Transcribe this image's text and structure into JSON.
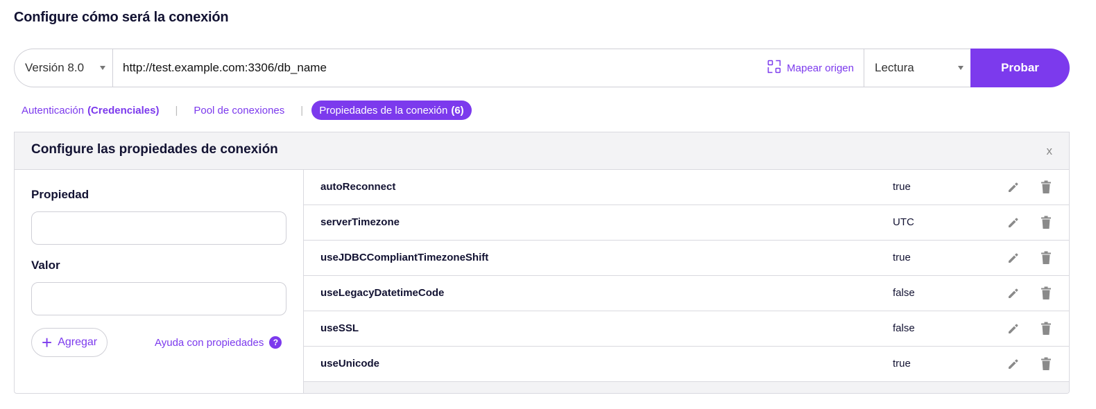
{
  "page": {
    "title": "Configure cómo será la conexión"
  },
  "connection": {
    "version_label": "Versión 8.0",
    "url_value": "http://test.example.com:3306/db_name",
    "map_origin_label": "Mapear origen",
    "mode_label": "Lectura",
    "test_label": "Probar"
  },
  "tabs": {
    "auth_label": "Autenticación",
    "auth_suffix": "(Credenciales)",
    "pool_label": "Pool de conexiones",
    "props_label": "Propiedades de la conexión",
    "props_count": "(6)",
    "separator": "|"
  },
  "panel": {
    "title": "Configure las propiedades de conexión",
    "close_label": "x",
    "property_label": "Propiedad",
    "property_value": "",
    "value_label": "Valor",
    "value_value": "",
    "add_label": "Agregar",
    "add_symbol": "+",
    "help_label": "Ayuda con propiedades",
    "help_symbol": "?"
  },
  "properties": [
    {
      "name": "autoReconnect",
      "value": "true"
    },
    {
      "name": "serverTimezone",
      "value": "UTC"
    },
    {
      "name": "useJDBCCompliantTimezoneShift",
      "value": "true"
    },
    {
      "name": "useLegacyDatetimeCode",
      "value": "false"
    },
    {
      "name": "useSSL",
      "value": "false"
    },
    {
      "name": "useUnicode",
      "value": "true"
    }
  ],
  "colors": {
    "accent": "#7c3aed",
    "icon_gray": "#8a8a8a"
  }
}
